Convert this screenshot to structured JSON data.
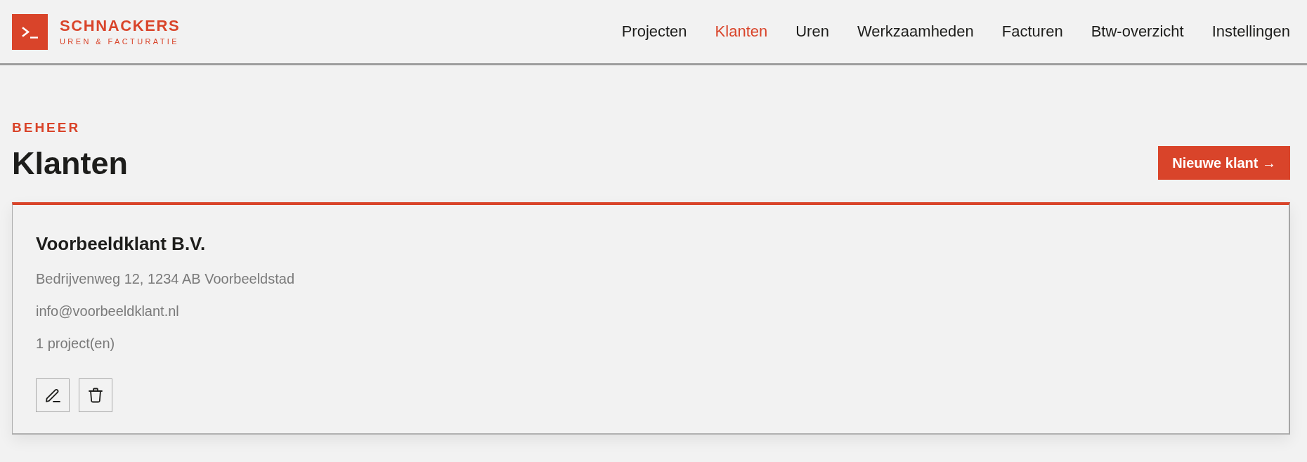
{
  "brand": {
    "name": "SCHNACKERS",
    "tagline": "UREN & FACTURATIE"
  },
  "nav": [
    {
      "label": "Projecten",
      "selected": false
    },
    {
      "label": "Klanten",
      "selected": true
    },
    {
      "label": "Uren",
      "selected": false
    },
    {
      "label": "Werkzaamheden",
      "selected": false
    },
    {
      "label": "Facturen",
      "selected": false
    },
    {
      "label": "Btw-overzicht",
      "selected": false
    },
    {
      "label": "Instellingen",
      "selected": false
    }
  ],
  "page": {
    "eyebrow": "BEHEER",
    "title": "Klanten",
    "new_button": "Nieuwe klant →"
  },
  "clients": [
    {
      "name": "Voorbeeldklant B.V.",
      "address": "Bedrijvenweg 12, 1234 AB Voorbeeldstad",
      "email": "info@voorbeeldklant.nl",
      "projects": "1 project(en)",
      "actions": [
        {
          "kind": "edit"
        },
        {
          "kind": "delete"
        }
      ]
    }
  ]
}
